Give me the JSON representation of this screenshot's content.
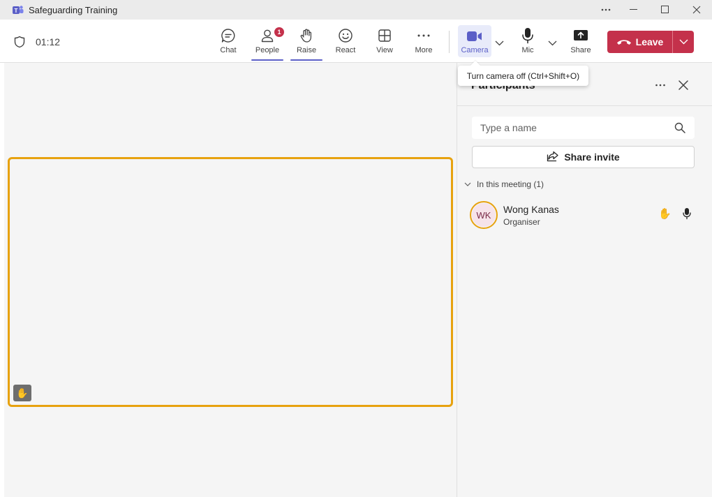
{
  "window": {
    "title": "Safeguarding Training",
    "accent": "#5b5fc7"
  },
  "toolbar": {
    "timer": "01:12",
    "buttons": {
      "chat": "Chat",
      "people": "People",
      "people_badge": "1",
      "raise": "Raise",
      "react": "React",
      "view": "View",
      "more": "More",
      "camera": "Camera",
      "mic": "Mic",
      "share": "Share"
    },
    "leave_label": "Leave",
    "leave_color": "#c4314b"
  },
  "tooltip": {
    "text": "Turn camera off (Ctrl+Shift+O)"
  },
  "stage": {
    "tile_border_color": "#e7a20f",
    "hand_emoji": "✋"
  },
  "panel": {
    "title": "Participants",
    "search_placeholder": "Type a name",
    "invite_label": "Share invite",
    "section_label": "In this meeting (1)",
    "participants": [
      {
        "initials": "WK",
        "name": "Wong Kanas",
        "role": "Organiser",
        "hand": "✋",
        "icons": [
          "hand-raised-icon",
          "mic-icon"
        ]
      }
    ]
  }
}
